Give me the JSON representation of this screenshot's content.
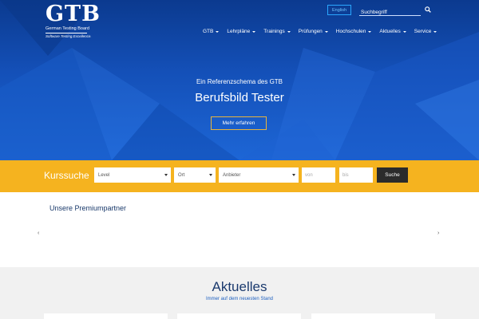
{
  "brand": {
    "logo_text": "GTB",
    "name": "German Testing Board",
    "claim": "Software.Testing.Excellence."
  },
  "header": {
    "lang_label": "English",
    "search_placeholder": "Suchbegriff",
    "search_icon": "search-icon"
  },
  "nav": {
    "items": [
      {
        "label": "GTB"
      },
      {
        "label": "Lehrpläne"
      },
      {
        "label": "Trainings"
      },
      {
        "label": "Prüfungen"
      },
      {
        "label": "Hochschulen"
      },
      {
        "label": "Aktuelles"
      },
      {
        "label": "Service"
      }
    ]
  },
  "hero": {
    "kicker": "Ein Referenzschema des GTB",
    "title": "Berufsbild Tester",
    "cta": "Mehr erfahren"
  },
  "kurssuche": {
    "title": "Kurssuche",
    "level": "Level",
    "ort": "Ort",
    "anbieter": "Anbieter",
    "von_placeholder": "von",
    "bis_placeholder": "bis",
    "button": "Suche"
  },
  "partners": {
    "title": "Unsere Premiumpartner",
    "prev": "‹",
    "next": "›"
  },
  "aktuelles": {
    "title": "Aktuelles",
    "subtitle": "Immer auf dem neuesten Stand"
  },
  "colors": {
    "brand_blue": "#1450b8",
    "accent_yellow": "#f5b31f",
    "dark": "#2b2b2b"
  }
}
